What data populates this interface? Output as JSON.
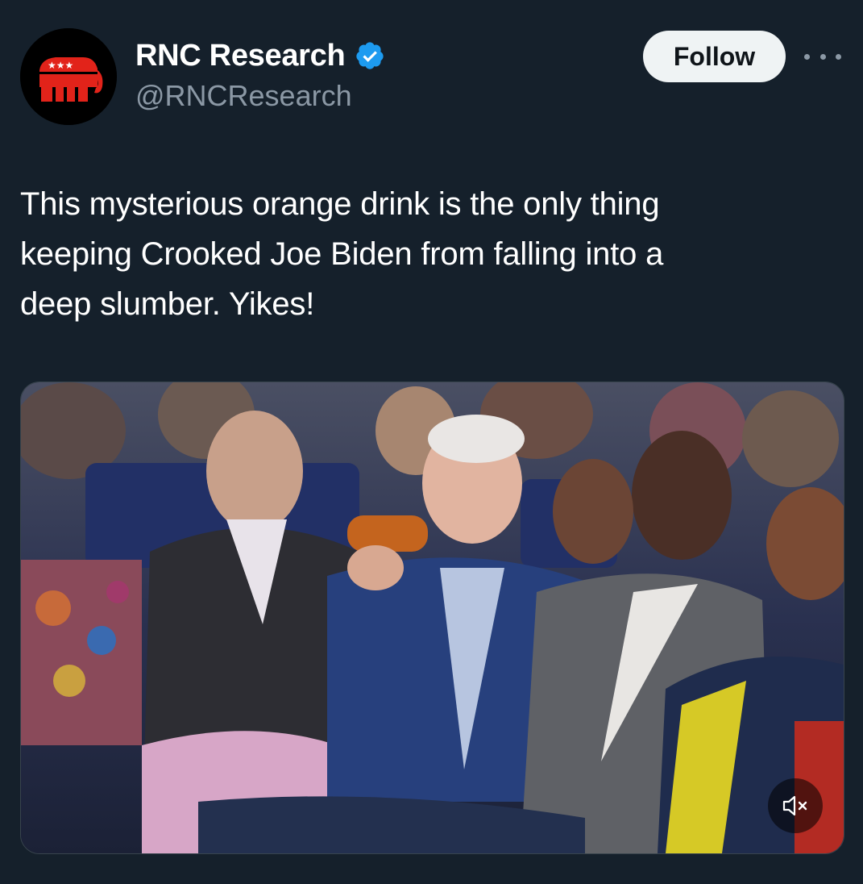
{
  "header": {
    "avatar_icon": "republican-elephant-logo",
    "display_name": "RNC Research",
    "verified_icon": "verified-badge-icon",
    "handle": "@RNCResearch",
    "follow_label": "Follow",
    "more_icon": "more-options-icon"
  },
  "tweet": {
    "line1": "This mysterious orange drink is the only thing",
    "line2": "keeping Crooked Joe Biden from falling into a",
    "line3": "deep slumber. Yikes!"
  },
  "media": {
    "type": "video",
    "mute_icon": "muted-speaker-icon"
  },
  "colors": {
    "background": "#15202b",
    "text_primary": "#ffffff",
    "text_secondary": "#8b98a5",
    "verified_blue": "#1d9bf0",
    "follow_bg": "#eff3f4",
    "logo_red": "#e2231a"
  }
}
